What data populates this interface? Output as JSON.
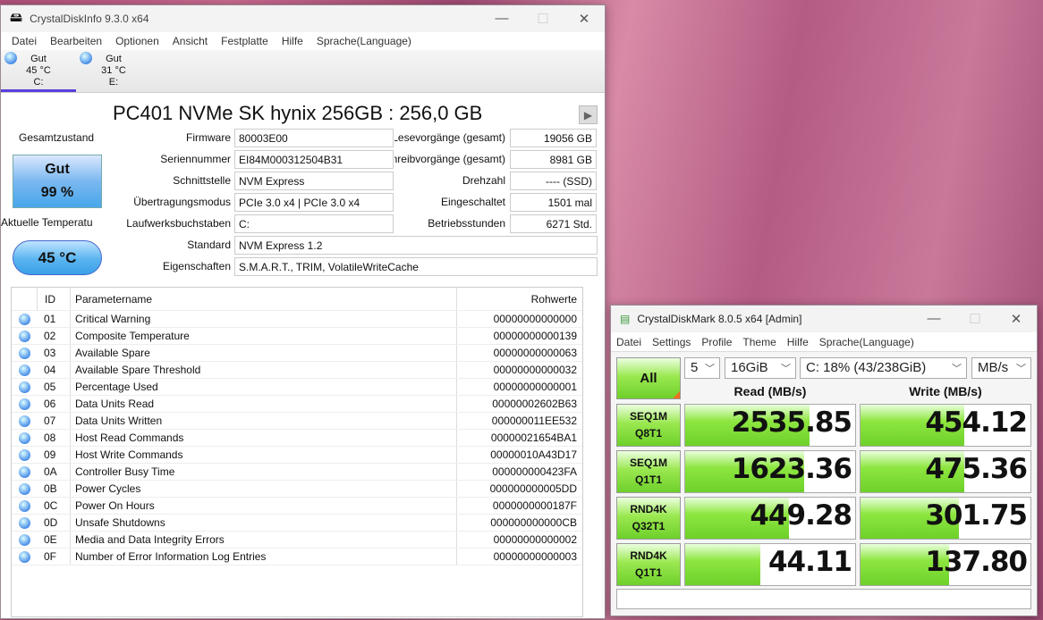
{
  "cdi": {
    "title": "CrystalDiskInfo 9.3.0 x64",
    "menu": [
      "Datei",
      "Bearbeiten",
      "Optionen",
      "Ansicht",
      "Festplatte",
      "Hilfe",
      "Sprache(Language)"
    ],
    "drives": [
      {
        "status": "Gut",
        "temp": "45 °C",
        "letter": "C:"
      },
      {
        "status": "Gut",
        "temp": "31 °C",
        "letter": "E:"
      }
    ],
    "model": "PC401 NVMe SK hynix 256GB : 256,0 GB",
    "health_label": "Gesamtzustand",
    "health_status": "Gut",
    "health_pct": "99 %",
    "temp_label": "Aktuelle Temperatu",
    "temp_value": "45 °C",
    "fields": {
      "firmware": {
        "label": "Firmware",
        "value": "80003E00"
      },
      "serial": {
        "label": "Seriennummer",
        "value": "EI84M000312504B31"
      },
      "interface": {
        "label": "Schnittstelle",
        "value": "NVM Express"
      },
      "transfer": {
        "label": "Übertragungsmodus",
        "value": "PCIe 3.0 x4 | PCIe 3.0 x4"
      },
      "letters": {
        "label": "Laufwerksbuchstaben",
        "value": "C:"
      },
      "standard": {
        "label": "Standard",
        "value": "NVM Express 1.2"
      },
      "features": {
        "label": "Eigenschaften",
        "value": "S.M.A.R.T., TRIM, VolatileWriteCache"
      },
      "reads": {
        "label": "Lesevorgänge (gesamt)",
        "value": "19056 GB"
      },
      "writes": {
        "label": "Schreibvorgänge (gesamt)",
        "value": "8981 GB"
      },
      "rpm": {
        "label": "Drehzahl",
        "value": "---- (SSD)"
      },
      "power_count": {
        "label": "Eingeschaltet",
        "value": "1501 mal"
      },
      "hours": {
        "label": "Betriebsstunden",
        "value": "6271 Std."
      }
    },
    "table": {
      "headers": [
        "ID",
        "Parametername",
        "Rohwerte"
      ],
      "rows": [
        [
          "01",
          "Critical Warning",
          "00000000000000"
        ],
        [
          "02",
          "Composite Temperature",
          "00000000000139"
        ],
        [
          "03",
          "Available Spare",
          "00000000000063"
        ],
        [
          "04",
          "Available Spare Threshold",
          "00000000000032"
        ],
        [
          "05",
          "Percentage Used",
          "00000000000001"
        ],
        [
          "06",
          "Data Units Read",
          "00000002602B63"
        ],
        [
          "07",
          "Data Units Written",
          "000000011EE532"
        ],
        [
          "08",
          "Host Read Commands",
          "00000021654BA1"
        ],
        [
          "09",
          "Host Write Commands",
          "00000010A43D17"
        ],
        [
          "0A",
          "Controller Busy Time",
          "000000000423FA"
        ],
        [
          "0B",
          "Power Cycles",
          "000000000005DD"
        ],
        [
          "0C",
          "Power On Hours",
          "0000000000187F"
        ],
        [
          "0D",
          "Unsafe Shutdowns",
          "000000000000CB"
        ],
        [
          "0E",
          "Media and Data Integrity Errors",
          "00000000000002"
        ],
        [
          "0F",
          "Number of Error Information Log Entries",
          "00000000000003"
        ]
      ]
    }
  },
  "cdm": {
    "title": "CrystalDiskMark 8.0.5 x64 [Admin]",
    "menu": [
      "Datei",
      "Settings",
      "Profile",
      "Theme",
      "Hilfe",
      "Sprache(Language)"
    ],
    "all_label": "All",
    "count": "5",
    "size": "16GiB",
    "drive": "C: 18% (43/238GiB)",
    "unit": "MB/s",
    "read_header": "Read (MB/s)",
    "write_header": "Write (MB/s)",
    "tests": [
      {
        "l1": "SEQ1M",
        "l2": "Q8T1",
        "read": "2535.85",
        "write": "454.12",
        "read_fill": 0.73,
        "write_fill": 0.61
      },
      {
        "l1": "SEQ1M",
        "l2": "Q1T1",
        "read": "1623.36",
        "write": "475.36",
        "read_fill": 0.7,
        "write_fill": 0.61
      },
      {
        "l1": "RND4K",
        "l2": "Q32T1",
        "read": "449.28",
        "write": "301.75",
        "read_fill": 0.61,
        "write_fill": 0.58
      },
      {
        "l1": "RND4K",
        "l2": "Q1T1",
        "read": "44.11",
        "write": "137.80",
        "read_fill": 0.44,
        "write_fill": 0.52
      }
    ]
  }
}
